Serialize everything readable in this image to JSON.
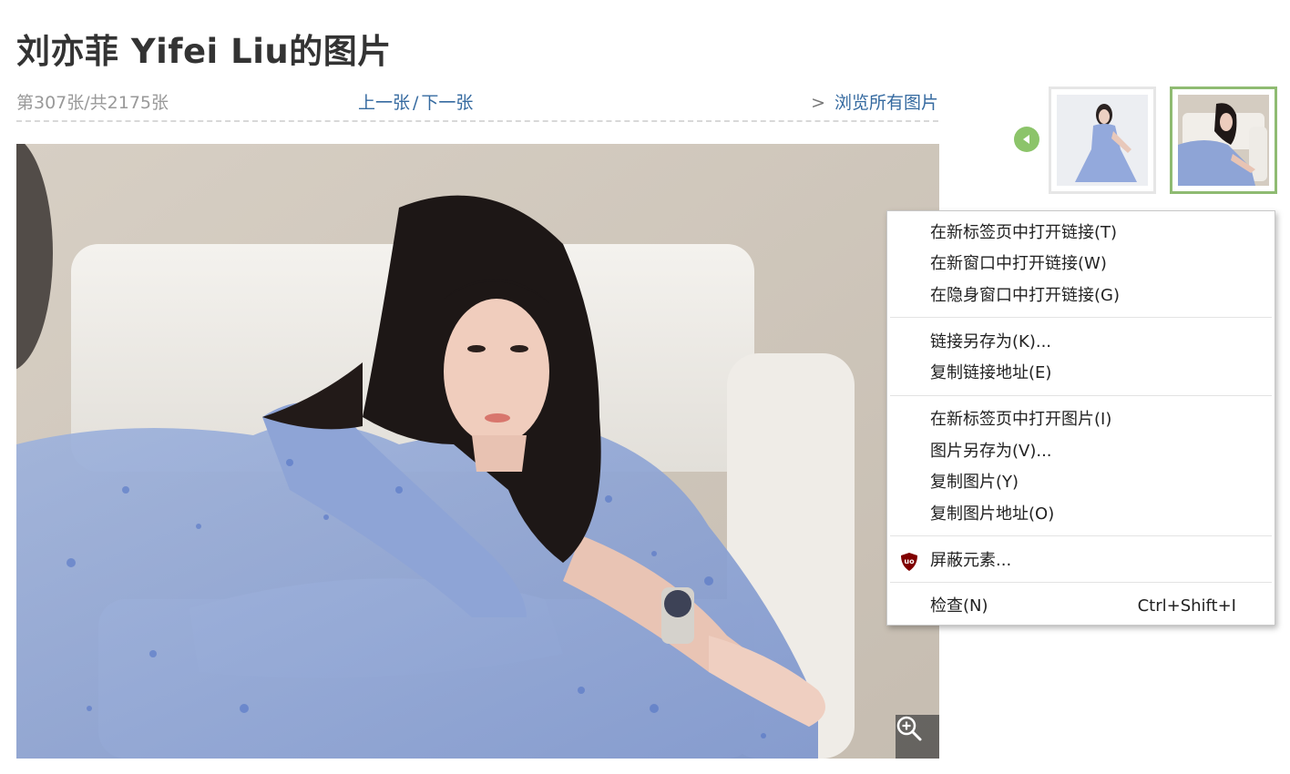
{
  "page": {
    "title": "刘亦菲 Yifei Liu的图片"
  },
  "nav": {
    "counter": "第307张/共2175张",
    "prev_label": "上一张",
    "separator": "/",
    "next_label": "下一张",
    "browse_arrow": ">",
    "browse_label": "浏览所有图片"
  },
  "thumbnails": {
    "prev_icon": "left-arrow-icon",
    "items": [
      {
        "name": "thumbnail-1",
        "selected": false
      },
      {
        "name": "thumbnail-2",
        "selected": true
      }
    ]
  },
  "photo": {
    "zoom_icon": "zoom-in-icon"
  },
  "context_menu": {
    "items": [
      {
        "label": "在新标签页中打开链接(T)"
      },
      {
        "label": "在新窗口中打开链接(W)"
      },
      {
        "label": "在隐身窗口中打开链接(G)"
      },
      {
        "label": "链接另存为(K)..."
      },
      {
        "label": "复制链接地址(E)"
      },
      {
        "label": "在新标签页中打开图片(I)"
      },
      {
        "label": "图片另存为(V)..."
      },
      {
        "label": "复制图片(Y)"
      },
      {
        "label": "复制图片地址(O)"
      },
      {
        "label": "屏蔽元素...",
        "icon": "ublock-origin-icon"
      },
      {
        "label": "检查(N)",
        "shortcut": "Ctrl+Shift+I"
      }
    ]
  },
  "colors": {
    "link": "#356aa0",
    "thumb_selected_border": "#8fbb72",
    "prev_arrow": "#8cc46a",
    "ublock_red": "#800000"
  }
}
